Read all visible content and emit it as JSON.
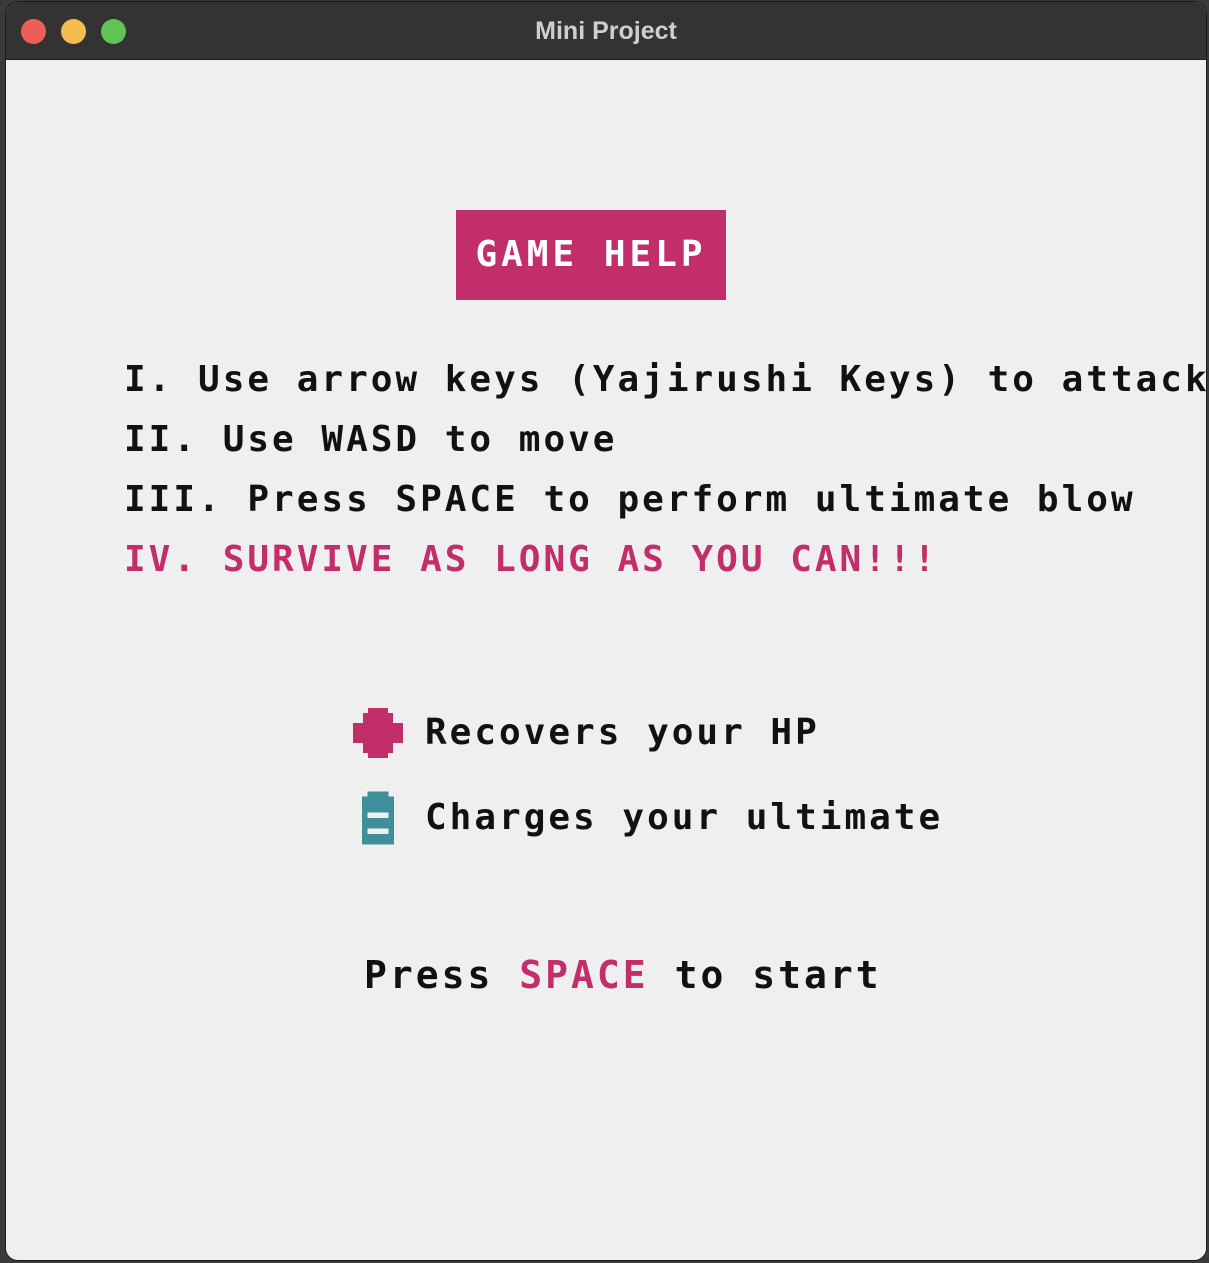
{
  "window": {
    "title": "Mini Project"
  },
  "help": {
    "title": "GAME HELP",
    "rules": [
      "I. Use arrow keys (Yajirushi Keys) to attack",
      "II. Use WASD to move",
      "III. Press SPACE to perform ultimate blow",
      "IV. SURVIVE AS LONG AS YOU CAN!!!"
    ]
  },
  "legend": {
    "items": [
      {
        "icon": "health-cross-icon",
        "label": "Recovers your HP"
      },
      {
        "icon": "battery-icon",
        "label": "Charges your ultimate"
      }
    ]
  },
  "start": {
    "prefix": "Press",
    "key": "SPACE",
    "suffix": "to start"
  },
  "colors": {
    "accent": "#c22e69",
    "battery": "#3f8f9a",
    "background": "#efefef",
    "text": "#111111"
  }
}
